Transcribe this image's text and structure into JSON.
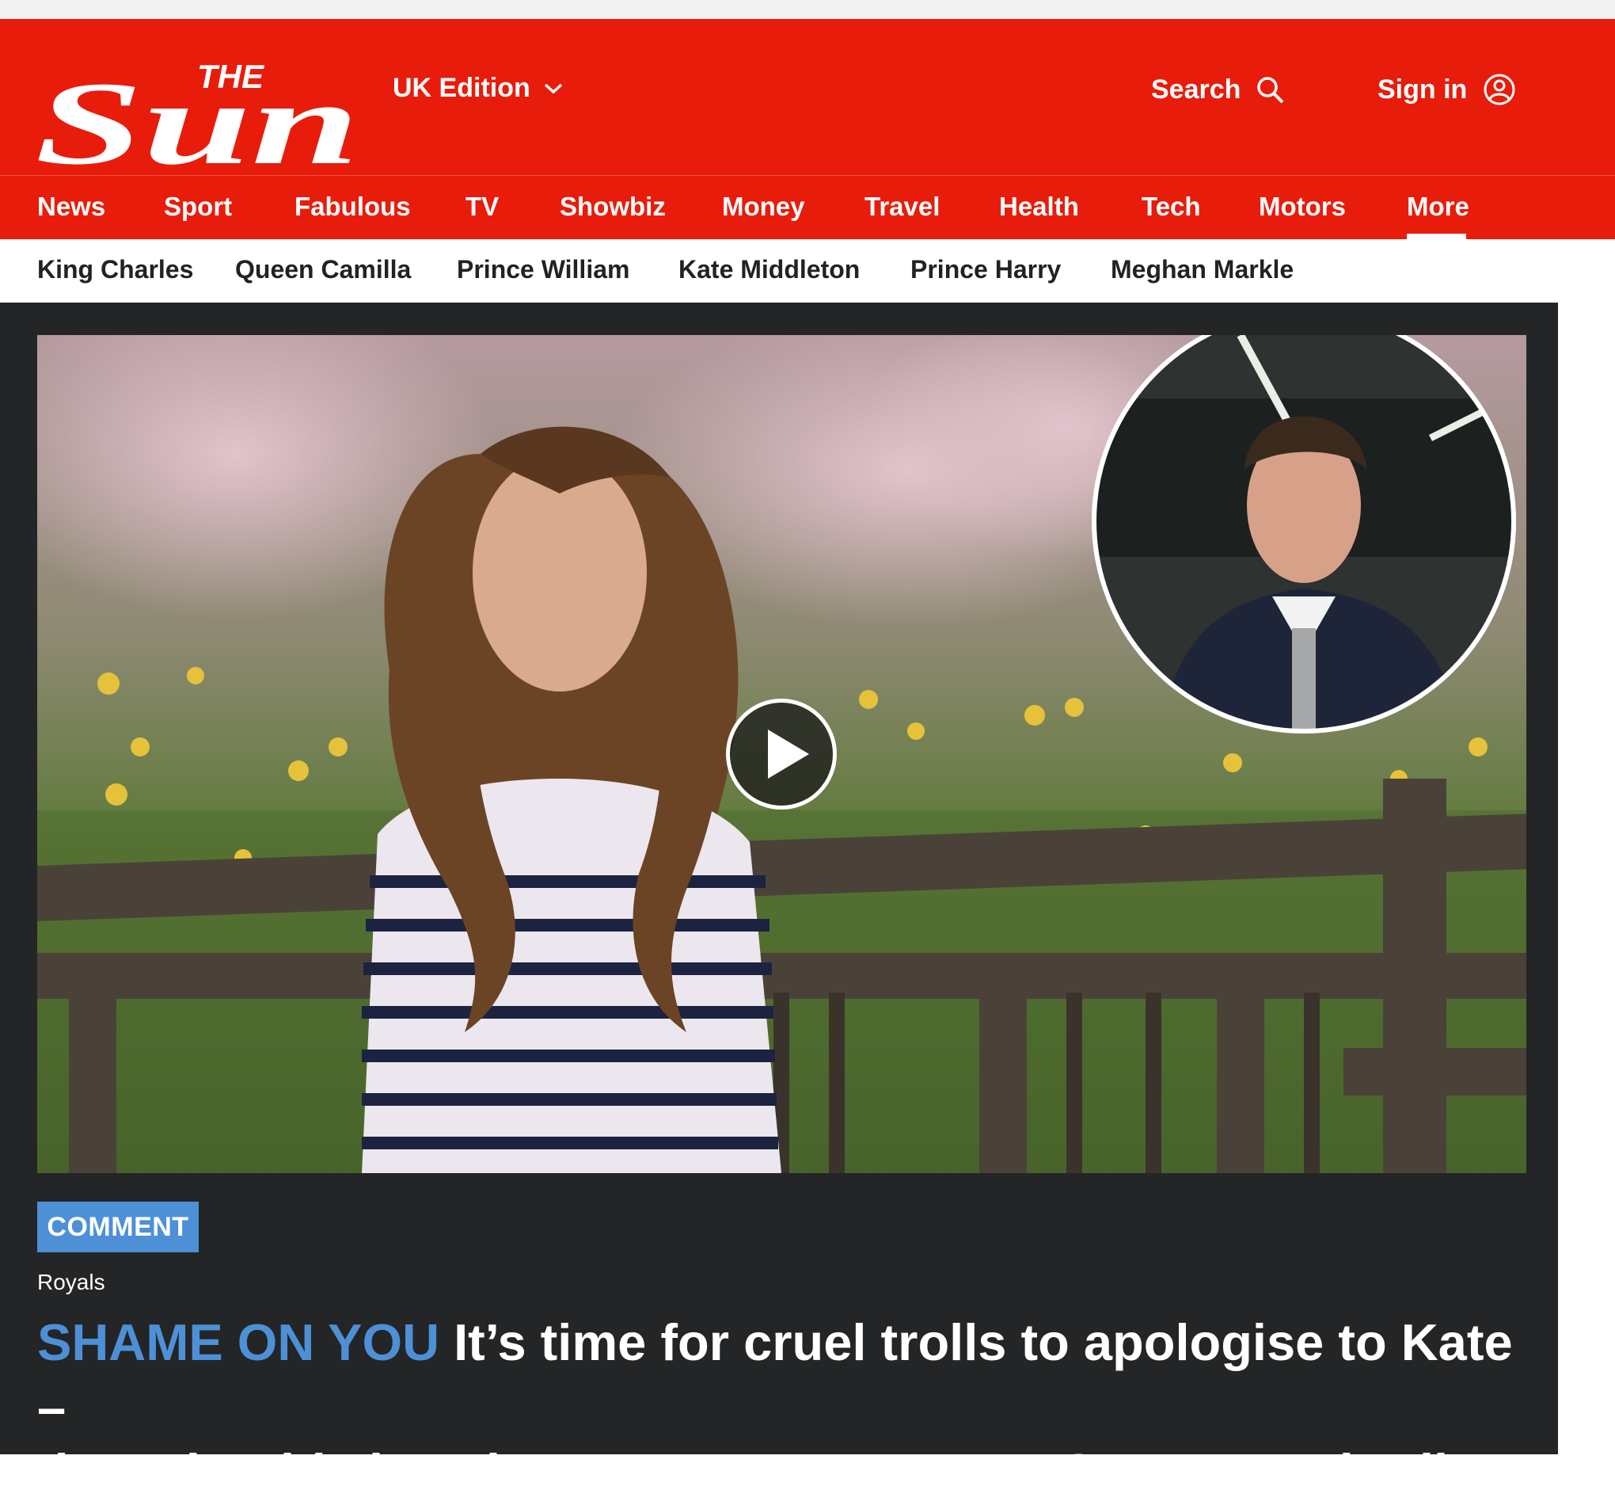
{
  "brand": {
    "logo_top": "THE",
    "logo_main": "Sun"
  },
  "header": {
    "edition_label": "UK Edition",
    "search_label": "Search",
    "signin_label": "Sign in"
  },
  "main_nav": {
    "items": [
      "News",
      "Sport",
      "Fabulous",
      "TV",
      "Showbiz",
      "Money",
      "Travel",
      "Health",
      "Tech",
      "Motors",
      "More"
    ],
    "active": "More"
  },
  "sub_nav": {
    "items": [
      "King Charles",
      "Queen Camilla",
      "Prince William",
      "Kate Middleton",
      "Prince Harry",
      "Meghan Markle"
    ]
  },
  "article": {
    "tag": "COMMENT",
    "section": "Royals",
    "kicker": "SHAME ON YOU",
    "headline_line1": " It’s time for cruel trolls to apologise to Kate –",
    "headline_line2": "they should show her more respect, says Sun’s Royal Editor"
  },
  "colors": {
    "brand_red": "#e81c0b",
    "kicker_blue": "#4d90d6",
    "content_bg": "#242526"
  },
  "icons": {
    "edition": "chevron-down-icon",
    "search": "search-icon",
    "signin": "user-circle-icon",
    "video": "play-icon"
  }
}
